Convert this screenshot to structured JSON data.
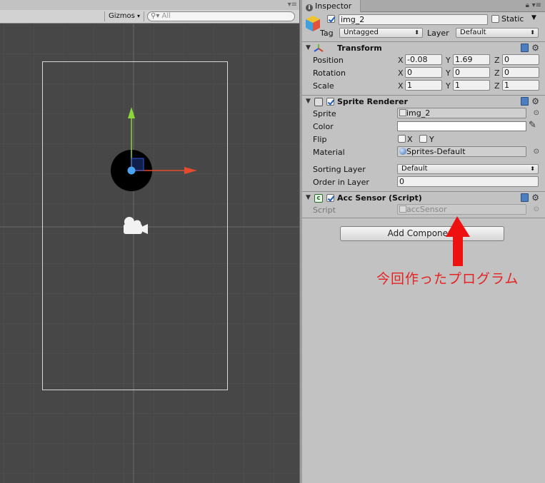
{
  "scene": {
    "gizmos_label": "Gizmos",
    "search_placeholder": "All",
    "colors": {
      "background": "#474747",
      "grid": "#555555",
      "frame": "#cfcfcf",
      "gizmo_x": "#e64a2e",
      "gizmo_y": "#8cd63a",
      "gizmo_z": "#2e59d9"
    },
    "icons": [
      "camera-icon",
      "move-gizmo-icon",
      "search-icon"
    ]
  },
  "inspector": {
    "tab_label": "Inspector",
    "object": {
      "active": true,
      "name": "img_2",
      "static_label": "Static",
      "static": false,
      "tag_label": "Tag",
      "tag_value": "Untagged",
      "layer_label": "Layer",
      "layer_value": "Default"
    },
    "transform": {
      "title": "Transform",
      "rows": [
        {
          "label": "Position",
          "x": "-0.08",
          "y": "1.69",
          "z": "0"
        },
        {
          "label": "Rotation",
          "x": "0",
          "y": "0",
          "z": "0"
        },
        {
          "label": "Scale",
          "x": "1",
          "y": "1",
          "z": "1"
        }
      ],
      "axes": {
        "x": "X",
        "y": "Y",
        "z": "Z"
      }
    },
    "sprite_renderer": {
      "title": "Sprite Renderer",
      "enabled": true,
      "sprite_label": "Sprite",
      "sprite_value": "img_2",
      "color_label": "Color",
      "color_value": "#ffffff",
      "flip_label": "Flip",
      "flip_x": "X",
      "flip_y": "Y",
      "material_label": "Material",
      "material_value": "Sprites-Default",
      "sorting_layer_label": "Sorting Layer",
      "sorting_layer_value": "Default",
      "order_label": "Order in Layer",
      "order_value": "0"
    },
    "acc_sensor": {
      "title": "Acc Sensor (Script)",
      "enabled": true,
      "script_label": "Script",
      "script_value": "accSensor"
    },
    "add_component_label": "Add Component"
  },
  "annotation": {
    "text": "今回作ったプログラム",
    "color": "#e52222"
  }
}
